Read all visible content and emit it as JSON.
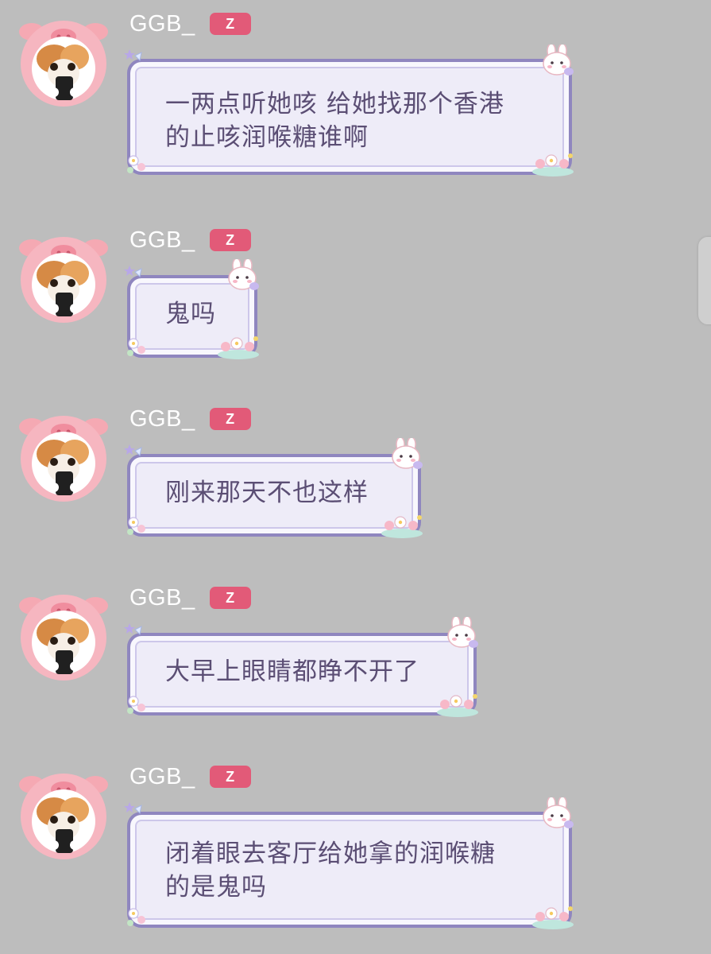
{
  "messages": [
    {
      "sender": "GGB_",
      "badge": "Z",
      "lines": [
        "一两点听她咳 给她找那个香港",
        "的止咳润喉糖谁啊"
      ]
    },
    {
      "sender": "GGB_",
      "badge": "Z",
      "lines": [
        "鬼吗"
      ]
    },
    {
      "sender": "GGB_",
      "badge": "Z",
      "lines": [
        "刚来那天不也这样"
      ]
    },
    {
      "sender": "GGB_",
      "badge": "Z",
      "lines": [
        "大早上眼睛都睁不开了"
      ]
    },
    {
      "sender": "GGB_",
      "badge": "Z",
      "lines": [
        "闭着眼去客厅给她拿的润喉糖",
        "的是鬼吗"
      ]
    }
  ],
  "colors": {
    "background": "#bdbdbd",
    "badge": "#e25a78",
    "bubble_fill": "#eeecf8",
    "bubble_border": "#8f86bf",
    "bubble_text": "#5b4e74"
  },
  "icons": [
    "pig-hood-cat-avatar-icon",
    "bunny-sticker-icon",
    "flower-cluster-icon",
    "heart-icon",
    "star-icon",
    "cloud-icon",
    "bee-icon"
  ]
}
